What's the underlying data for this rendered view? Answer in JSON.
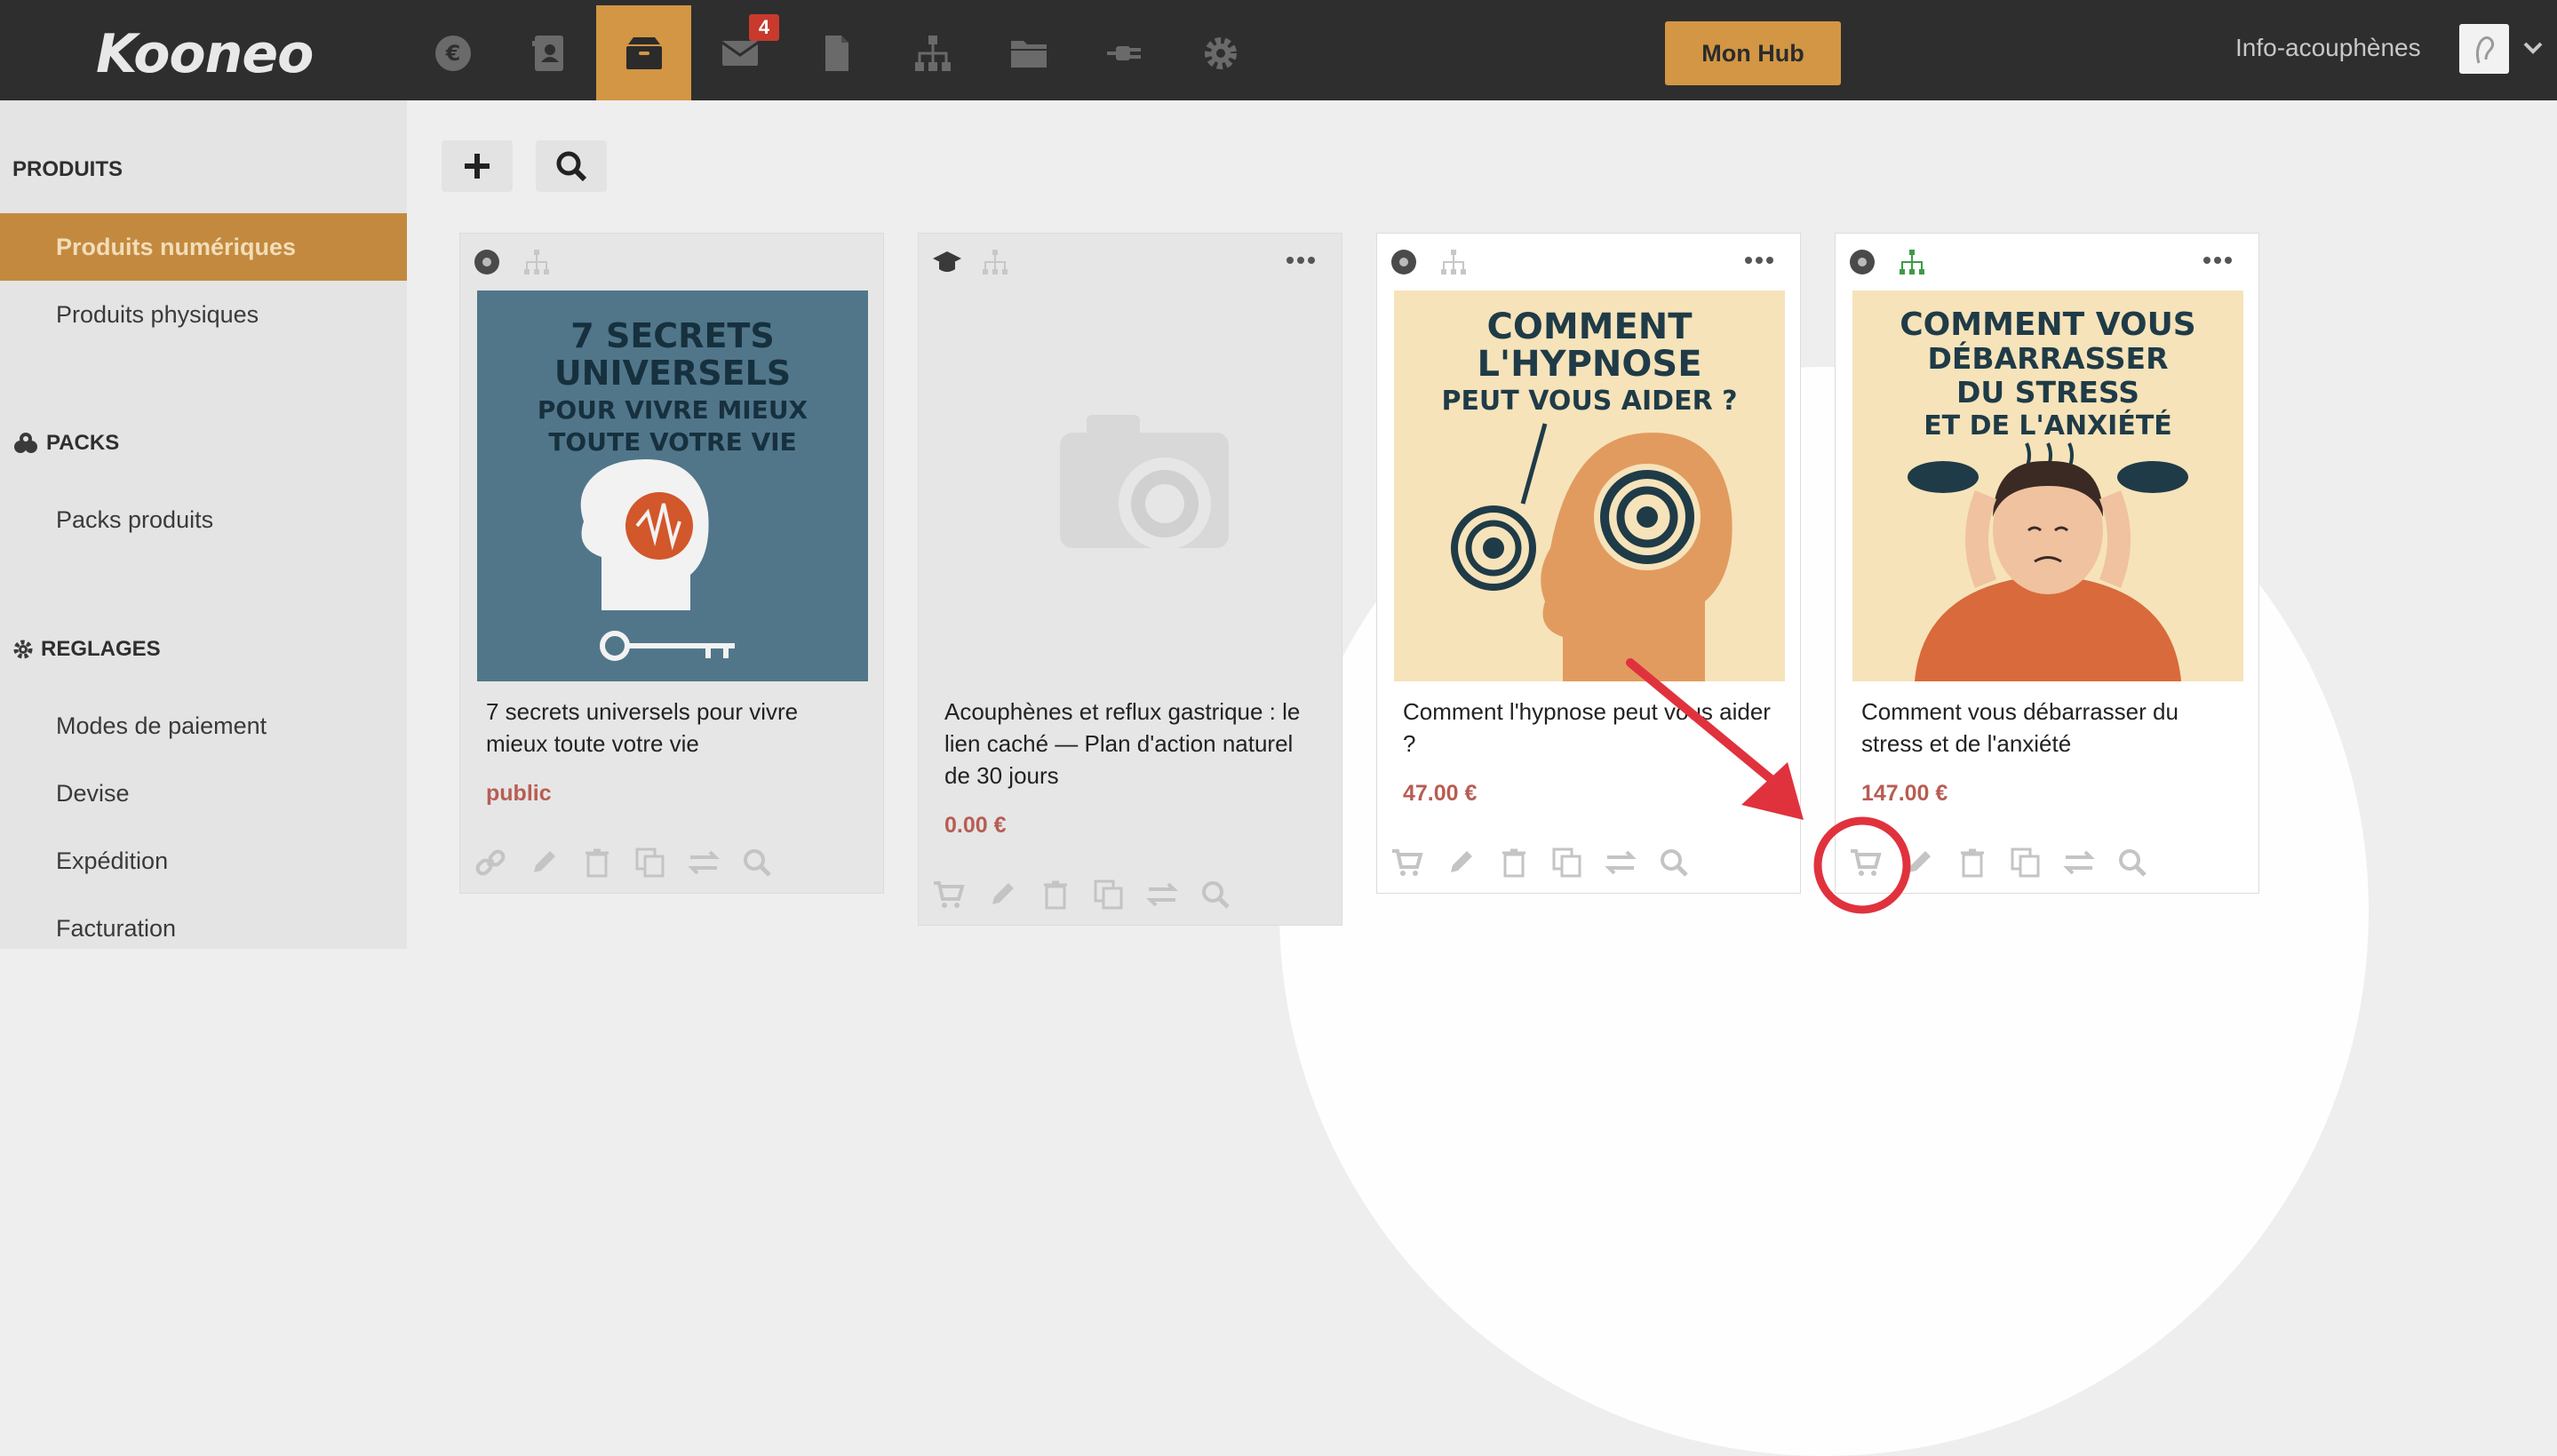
{
  "app": {
    "logo": "Kooneo"
  },
  "topbar": {
    "nav_icons": [
      {
        "name": "euro-icon"
      },
      {
        "name": "contact-card-icon"
      },
      {
        "name": "box-icon",
        "active": true
      },
      {
        "name": "mail-icon",
        "badge": "4"
      },
      {
        "name": "file-icon"
      },
      {
        "name": "sitemap-icon"
      },
      {
        "name": "folder-icon"
      },
      {
        "name": "plug-icon"
      },
      {
        "name": "gear-icon"
      }
    ],
    "mail_badge": "4",
    "hub_button": "Mon Hub",
    "account_name": "Info-acouphènes"
  },
  "sidebar": {
    "sections": [
      {
        "title": "PRODUITS",
        "items": [
          "Produits numériques",
          "Produits physiques"
        ]
      },
      {
        "title": "PACKS",
        "items": [
          "Packs produits"
        ]
      },
      {
        "title": "REGLAGES",
        "items": [
          "Modes de paiement",
          "Devise",
          "Expédition",
          "Facturation"
        ]
      }
    ],
    "active_item": "Produits numériques"
  },
  "toolbar": {
    "add_icon": "plus-icon",
    "search_icon": "search-icon"
  },
  "products": [
    {
      "title": "7 secrets universels pour vivre mieux toute votre vie",
      "price": "public",
      "thumb_lines": [
        "7 SECRETS",
        "UNIVERSELS",
        "POUR VIVRE MIEUX",
        "TOUTE VOTRE VIE"
      ]
    },
    {
      "title": "Acouphènes et reflux gastrique : le lien caché — Plan d'action naturel de 30 jours",
      "price": "0.00 €",
      "thumb_lines": []
    },
    {
      "title": "Comment l'hypnose peut vous aider ?",
      "price": "47.00 €",
      "thumb_lines": [
        "COMMENT",
        "L'HYPNOSE",
        "PEUT VOUS AIDER ?"
      ]
    },
    {
      "title": "Comment vous débarrasser du stress et de l'anxiété",
      "price": "147.00 €",
      "thumb_lines": [
        "COMMENT VOUS",
        "DÉBARRASSER",
        "DU STRESS",
        "ET DE L'ANXIÉTÉ"
      ]
    }
  ],
  "colors": {
    "accent": "#d29644",
    "price": "#b85d53",
    "annotation": "#e0323d",
    "topbar": "#2e2e2e"
  }
}
